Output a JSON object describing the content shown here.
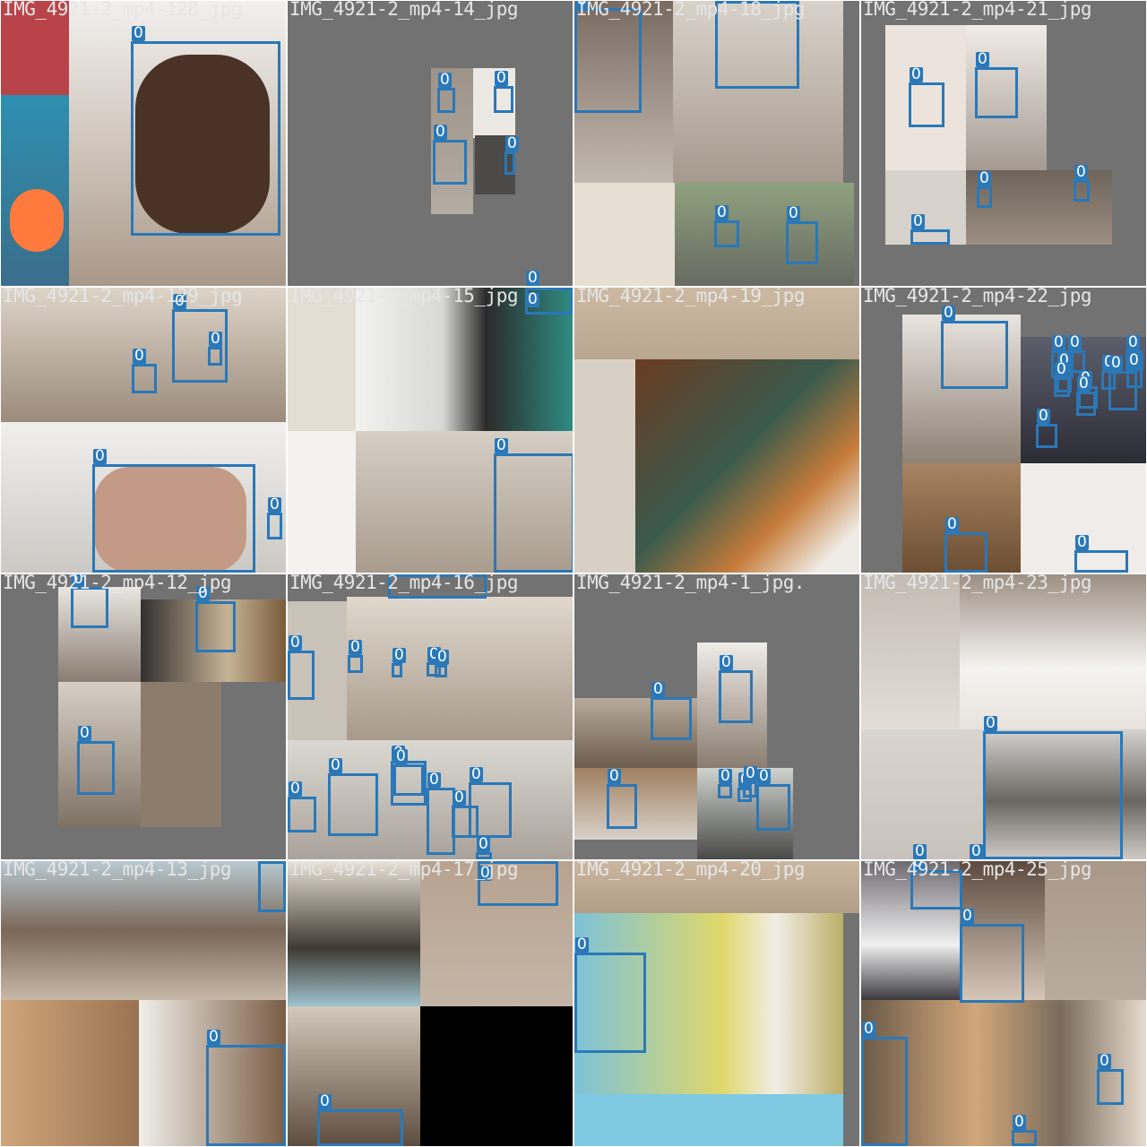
{
  "mosaic": {
    "label_color": "#2a78b8",
    "tiles": [
      {
        "title": "IMG_4921-2_mp4-128_jpg",
        "boxes": [
          "0"
        ]
      },
      {
        "title": "IMG_4921-2_mp4-14_jpg",
        "boxes": [
          "0",
          "0",
          "0",
          "0",
          "0"
        ]
      },
      {
        "title": "IMG_4921-2_mp4-18_jpg",
        "boxes": [
          "0",
          "0",
          "0",
          "0"
        ]
      },
      {
        "title": "IMG_4921-2_mp4-21_jpg",
        "boxes": [
          "0",
          "0",
          "0",
          "0",
          "0"
        ]
      },
      {
        "title": "IMG_4921-2_mp4-129_jpg",
        "boxes": [
          "0",
          "0",
          "0",
          "0",
          "0"
        ]
      },
      {
        "title": "IMG_4921-2_mp4-15_jpg",
        "boxes": [
          "0",
          "0"
        ]
      },
      {
        "title": "IMG_4921-2_mp4-19_jpg",
        "boxes": []
      },
      {
        "title": "IMG_4921-2_mp4-22_jpg",
        "boxes": [
          "0",
          "0",
          "0",
          "0",
          "0",
          "0",
          "0",
          "0",
          "0",
          "0",
          "0",
          "0"
        ]
      },
      {
        "title": "IMG_4921-2_mp4-12_jpg",
        "boxes": [
          "0",
          "0",
          "0"
        ]
      },
      {
        "title": "IMG_4921-2_mp4-16_jpg",
        "boxes": [
          "0",
          "0",
          "0",
          "0",
          "0",
          "0",
          "0",
          "0",
          "0",
          "0",
          "0",
          "0",
          "0",
          "0"
        ]
      },
      {
        "title": "IMG_4921-2_mp4-1_jpg.",
        "boxes": [
          "0",
          "0",
          "0",
          "0",
          "0",
          "0",
          "0"
        ]
      },
      {
        "title": "IMG_4921-2_mp4-23_jpg",
        "boxes": [
          "0",
          "0",
          "0"
        ]
      },
      {
        "title": "IMG_4921-2_mp4-13_jpg",
        "boxes": [
          "0",
          "0"
        ]
      },
      {
        "title": "IMG_4921-2_mp4-17_jpg",
        "boxes": [
          "0",
          "0"
        ]
      },
      {
        "title": "IMG_4921-2_mp4-20_jpg",
        "boxes": [
          "0"
        ]
      },
      {
        "title": "IMG_4921-2_mp4-25_jpg",
        "boxes": [
          "0",
          "0",
          "0",
          "0",
          "0"
        ]
      }
    ]
  }
}
